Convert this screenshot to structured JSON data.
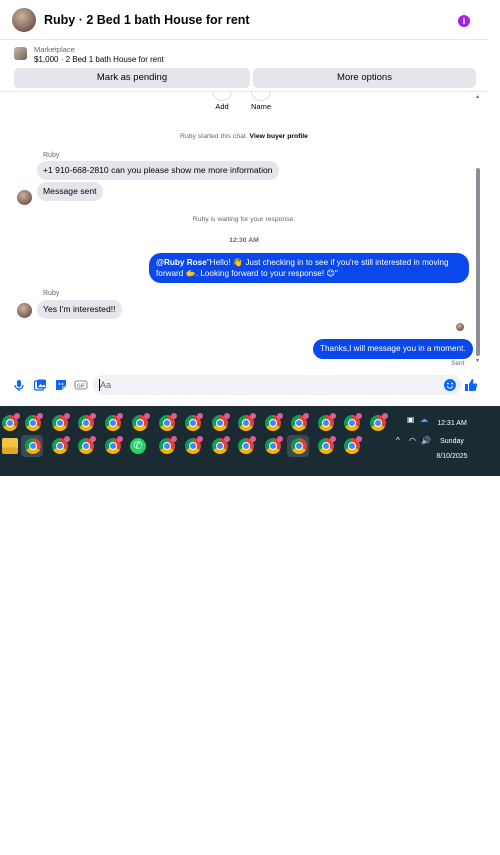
{
  "header": {
    "title": "Ruby · 2 Bed 1 bath House for rent",
    "menu_icon": "i"
  },
  "listing": {
    "source": "Marketplace",
    "info": "$1,000 · 2 Bed 1 bath House for rent"
  },
  "actions": {
    "pending_label": "Mark as pending",
    "more_label": "More options"
  },
  "quick_actions": [
    {
      "label": "Add"
    },
    {
      "label": "Name"
    }
  ],
  "conversation": {
    "started_text": "Ruby started this chat.",
    "view_profile": "View buyer profile",
    "sender": "Ruby",
    "msg1": "+1 910-668-2810 can you please show me more information",
    "msg2": "Message sent",
    "waiting_text": "Ruby is waiting for your response.",
    "timestamp": "12:30 AM",
    "out1_mention": "@Ruby Rose",
    "out1_text": "\"Hello! 👋 Just checking in to see if you're still interested in moving forward 🫱. Looking forward to your response! 😊\"",
    "sender2": "Ruby",
    "msg3": "Yes I'm interested!!",
    "out2_text": "Thanks,I will message you in a moment.",
    "sent_label": "Sent"
  },
  "composer": {
    "placeholder": "Aa"
  },
  "taskbar": {
    "time": "12:31 AM",
    "day": "Sunday",
    "date": "8/10/2025",
    "notification_count": "7"
  },
  "colors": {
    "accent": "#0a48ec",
    "incoming_bubble": "#e4e6eb",
    "taskbar_bg": "#1b2b34"
  }
}
